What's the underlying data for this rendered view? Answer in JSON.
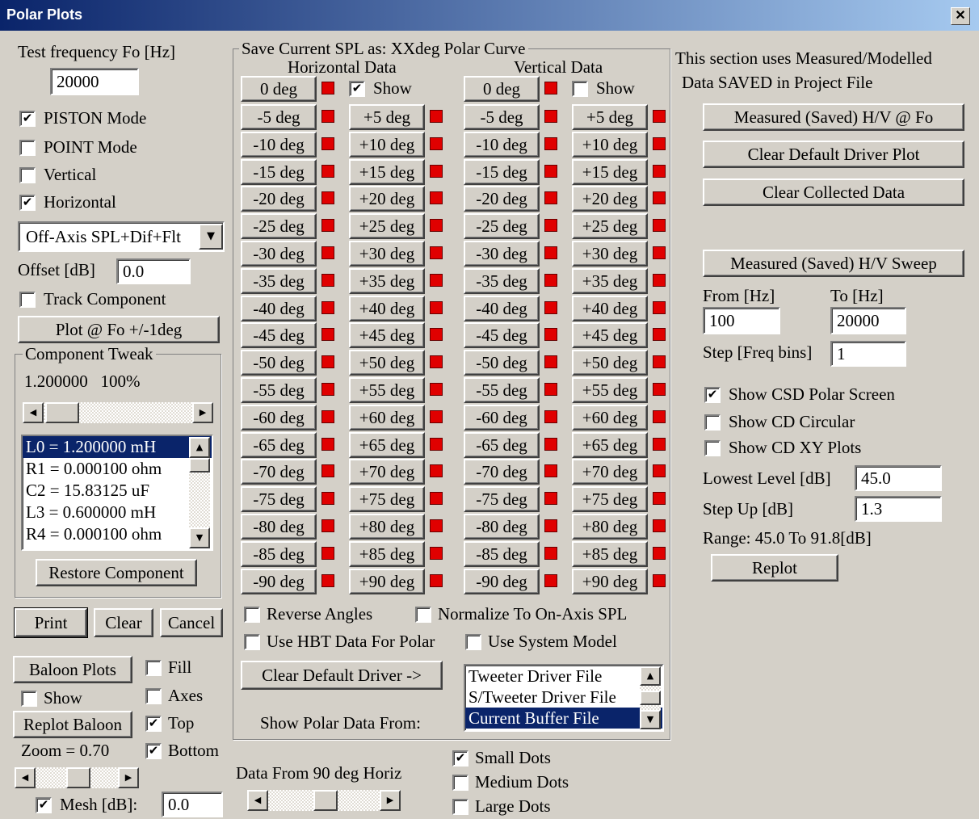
{
  "window": {
    "title": "Polar Plots",
    "close": "✕"
  },
  "left": {
    "test_freq_label": "Test frequency Fo [Hz]",
    "test_freq_value": "20000",
    "piston": {
      "label": "PISTON Mode",
      "checked": "✔"
    },
    "point": {
      "label": "POINT Mode",
      "checked": ""
    },
    "vertical": {
      "label": "Vertical",
      "checked": ""
    },
    "horizontal": {
      "label": "Horizontal",
      "checked": "✔"
    },
    "mode_select": "Off-Axis SPL+Dif+Flt",
    "offset_label": "Offset [dB]",
    "offset_value": "0.0",
    "track": {
      "label": "Track Component",
      "checked": ""
    },
    "plot_btn": "Plot @ Fo +/-1deg",
    "tweak_group": "Component Tweak",
    "tweak_value": "1.200000   100%",
    "components": [
      "L0 = 1.200000 mH",
      "R1 = 0.000100 ohm",
      "C2 = 15.83125 uF",
      "L3 = 0.600000 mH",
      "R4 = 0.000100 ohm"
    ],
    "restore_btn": "Restore Component",
    "print_btn": "Print",
    "clear_btn": "Clear",
    "cancel_btn": "Cancel",
    "baloon_btn": "Baloon Plots",
    "fill": {
      "label": "Fill",
      "checked": ""
    },
    "show": {
      "label": "Show",
      "checked": ""
    },
    "axes": {
      "label": "Axes",
      "checked": ""
    },
    "replot_baloon_btn": "Replot Baloon",
    "top": {
      "label": "Top",
      "checked": "✔"
    },
    "zoom_label": "Zoom = 0.70",
    "bottom": {
      "label": "Bottom",
      "checked": "✔"
    },
    "mesh": {
      "label": "Mesh [dB]:",
      "checked": "✔",
      "value": "0.0"
    }
  },
  "center": {
    "group_title": "Save Current SPL as: XXdeg Polar Curve",
    "horiz_title": "Horizontal Data",
    "vert_title": "Vertical Data",
    "zero_btn": "0 deg",
    "show_h": {
      "label": "Show",
      "checked": "✔"
    },
    "show_v": {
      "label": "Show",
      "checked": ""
    },
    "neg": [
      "-5 deg",
      "-10 deg",
      "-15 deg",
      "-20 deg",
      "-25 deg",
      "-30 deg",
      "-35 deg",
      "-40 deg",
      "-45 deg",
      "-50 deg",
      "-55 deg",
      "-60 deg",
      "-65 deg",
      "-70 deg",
      "-75 deg",
      "-80 deg",
      "-85 deg",
      "-90 deg"
    ],
    "pos": [
      "+5 deg",
      "+10 deg",
      "+15 deg",
      "+20 deg",
      "+25 deg",
      "+30 deg",
      "+35 deg",
      "+40 deg",
      "+45 deg",
      "+50 deg",
      "+55 deg",
      "+60 deg",
      "+65 deg",
      "+70 deg",
      "+75 deg",
      "+80 deg",
      "+85 deg",
      "+90 deg"
    ],
    "reverse": {
      "label": "Reverse Angles",
      "checked": ""
    },
    "normalize": {
      "label": "Normalize To On-Axis SPL",
      "checked": ""
    },
    "use_hbt": {
      "label": "Use HBT Data For Polar",
      "checked": ""
    },
    "use_system": {
      "label": "Use System Model",
      "checked": ""
    },
    "clear_driver_btn": "Clear Default Driver ->",
    "show_from_label": "Show Polar Data From:",
    "files": [
      "Tweeter Driver File",
      "S/Tweeter Driver File",
      "Current Buffer File"
    ],
    "data_from_label": "Data From 90 deg Horiz",
    "small": {
      "label": "Small Dots",
      "checked": "✔"
    },
    "medium": {
      "label": "Medium Dots",
      "checked": ""
    },
    "large": {
      "label": "Large Dots",
      "checked": ""
    }
  },
  "right": {
    "info_line1": "This section uses Measured/Modelled",
    "info_line2": "Data SAVED in Project File",
    "measured_fo_btn": "Measured (Saved) H/V @ Fo",
    "clear_default_btn": "Clear Default Driver Plot",
    "clear_collected_btn": "Clear Collected Data",
    "sweep_btn": "Measured (Saved) H/V Sweep",
    "from_label": "From [Hz]",
    "to_label": "To [Hz]",
    "from_value": "100",
    "to_value": "20000",
    "step_label": "Step [Freq bins]",
    "step_value": "1",
    "csd_polar": {
      "label": "Show CSD Polar Screen",
      "checked": "✔"
    },
    "cd_circular": {
      "label": "Show CD Circular",
      "checked": ""
    },
    "cd_xy": {
      "label": "Show CD XY Plots",
      "checked": ""
    },
    "lowest_label": "Lowest Level [dB]",
    "lowest_value": "45.0",
    "stepup_label": "Step Up [dB]",
    "stepup_value": "1.3",
    "range_text": "Range: 45.0 To 91.8[dB]",
    "replot_btn": "Replot"
  }
}
